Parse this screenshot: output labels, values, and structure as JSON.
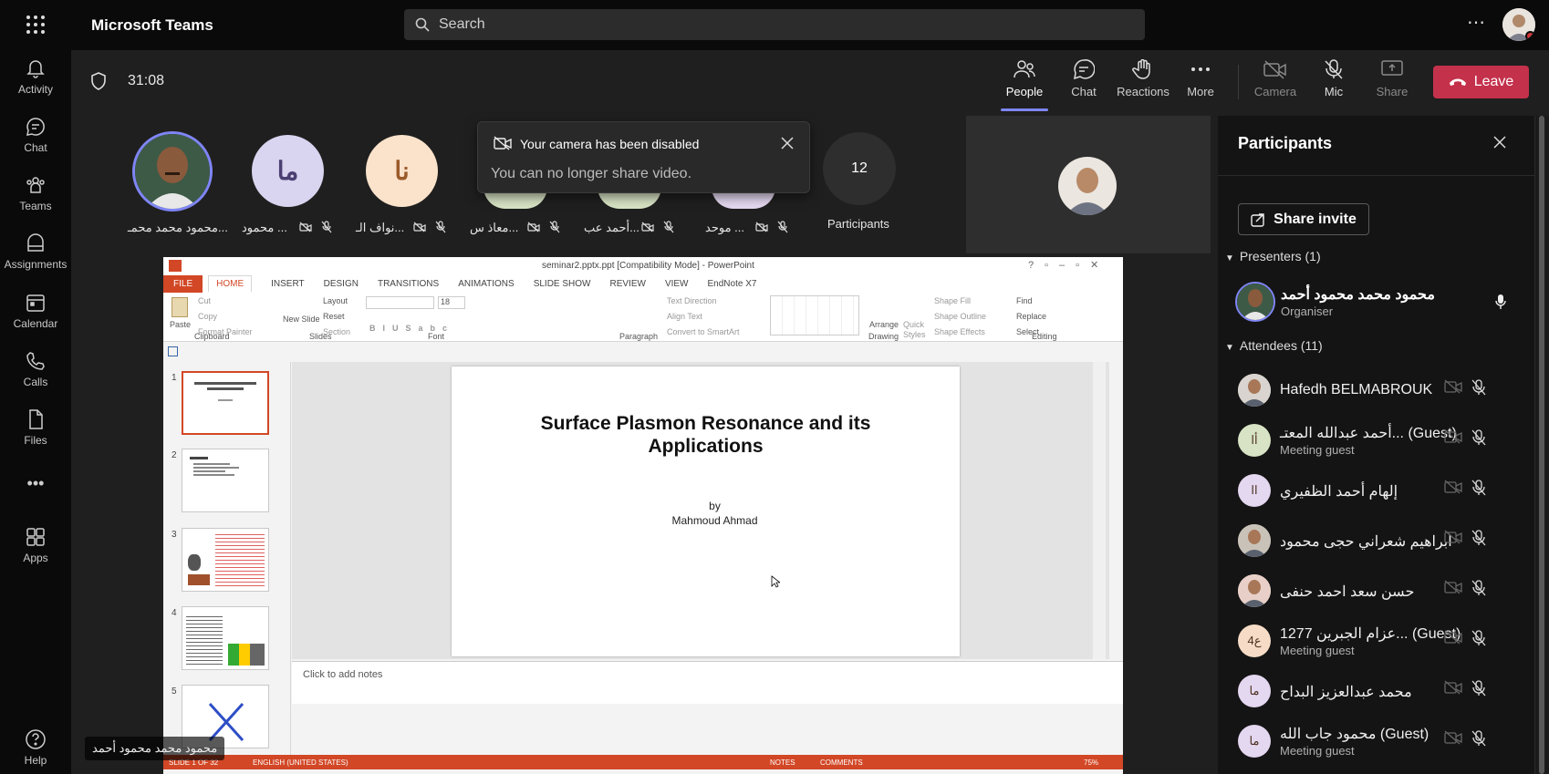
{
  "app": {
    "title": "Microsoft Teams",
    "search_placeholder": "Search",
    "more": "⋯"
  },
  "rail": [
    {
      "label": "Activity",
      "icon": "bell-icon"
    },
    {
      "label": "Chat",
      "icon": "chat-icon"
    },
    {
      "label": "Teams",
      "icon": "teams-icon"
    },
    {
      "label": "Assignments",
      "icon": "assignments-icon"
    },
    {
      "label": "Calendar",
      "icon": "calendar-icon"
    },
    {
      "label": "Calls",
      "icon": "phone-icon"
    },
    {
      "label": "Files",
      "icon": "file-icon"
    },
    {
      "label": "Apps",
      "icon": "apps-icon"
    },
    {
      "label": "Help",
      "icon": "help-icon"
    }
  ],
  "meeting": {
    "timer": "31:08",
    "buttons": {
      "people": "People",
      "chat": "Chat",
      "reactions": "Reactions",
      "more": "More",
      "camera": "Camera",
      "mic": "Mic",
      "share": "Share",
      "leave": "Leave"
    },
    "toast": {
      "title": "Your camera has been disabled",
      "body": "You can no longer share video."
    },
    "tiles": [
      {
        "name": "محمود محمد محمـ...",
        "initials": ""
      },
      {
        "name": "محمود ...",
        "initials": "ما"
      },
      {
        "name": "نواف الـ...",
        "initials": "نا"
      },
      {
        "name": "معاذ س...",
        "initials": ""
      },
      {
        "name": "أحمد عب...",
        "initials": ""
      },
      {
        "name": "موحد ...",
        "initials": ""
      }
    ],
    "overflow": {
      "count": "12",
      "label": "Participants"
    },
    "presenter_label": "محمود محمد محمود أحمد"
  },
  "panel": {
    "title": "Participants",
    "share_invite": "Share invite",
    "presenters_heading": "Presenters (1)",
    "presenter": {
      "name": "محمود محمد محمود أحمد",
      "role": "Organiser"
    },
    "attendees_heading": "Attendees (11)",
    "attendees": [
      {
        "name": "Hafedh BELMABROUK",
        "sub": "",
        "initials": "",
        "bg": "#d9d4cf"
      },
      {
        "name": "أحمد عبدالله المعتـ... (Guest)",
        "sub": "Meeting guest",
        "initials": "أا",
        "bg": "#d7e3c4"
      },
      {
        "name": "إلهام أحمد الظفيري",
        "sub": "",
        "initials": "اا",
        "bg": "#e4d7f0"
      },
      {
        "name": "ابراهيم شعراني حجى محمود",
        "sub": "",
        "initials": "",
        "bg": "#c9c2b8"
      },
      {
        "name": "حسن سعد احمد حنفى",
        "sub": "",
        "initials": "",
        "bg": "#e8d0c8"
      },
      {
        "name": "عزام الجبرين 1277... (Guest)",
        "sub": "Meeting guest",
        "initials": "ع4",
        "bg": "#f6dcc6"
      },
      {
        "name": "محمد عبدالعزيز البداح",
        "sub": "",
        "initials": "ما",
        "bg": "#e4d7f0"
      },
      {
        "name": "محمود جاب الله (Guest)",
        "sub": "Meeting guest",
        "initials": "ما",
        "bg": "#e4d7f0"
      }
    ]
  },
  "ppt": {
    "window_title": "seminar2.pptx.ppt [Compatibility Mode] - PowerPoint",
    "file_tab": "FILE",
    "tabs": [
      "HOME",
      "INSERT",
      "DESIGN",
      "TRANSITIONS",
      "ANIMATIONS",
      "SLIDE SHOW",
      "REVIEW",
      "VIEW",
      "EndNote X7"
    ],
    "groups": [
      "Clipboard",
      "Slides",
      "Font",
      "Paragraph",
      "Drawing",
      "Editing"
    ],
    "clipboard": {
      "paste": "Paste",
      "cut": "Cut",
      "copy": "Copy",
      "format_painter": "Format Painter"
    },
    "slides_group": {
      "new_slide": "New Slide",
      "layout": "Layout",
      "reset": "Reset",
      "section": "Section"
    },
    "font_size": "18",
    "paragraph": {
      "text_direction": "Text Direction",
      "align_text": "Align Text",
      "convert": "Convert to SmartArt"
    },
    "drawing": {
      "arrange": "Arrange",
      "quick_styles": "Quick Styles",
      "shape_fill": "Shape Fill",
      "shape_outline": "Shape Outline",
      "shape_effects": "Shape Effects"
    },
    "editing": {
      "find": "Find",
      "replace": "Replace",
      "select": "Select"
    },
    "slide": {
      "title_line1": "Surface Plasmon Resonance and its",
      "title_line2": "Applications",
      "by": "by",
      "author": "Mahmoud Ahmad"
    },
    "thumbnails": [
      "1",
      "2",
      "3",
      "4",
      "5"
    ],
    "notes_placeholder": "Click to add notes",
    "status": {
      "slide": "SLIDE 1 OF 32",
      "language": "ENGLISH (UNITED STATES)",
      "notes": "NOTES",
      "comments": "COMMENTS",
      "zoom": "75%"
    }
  }
}
